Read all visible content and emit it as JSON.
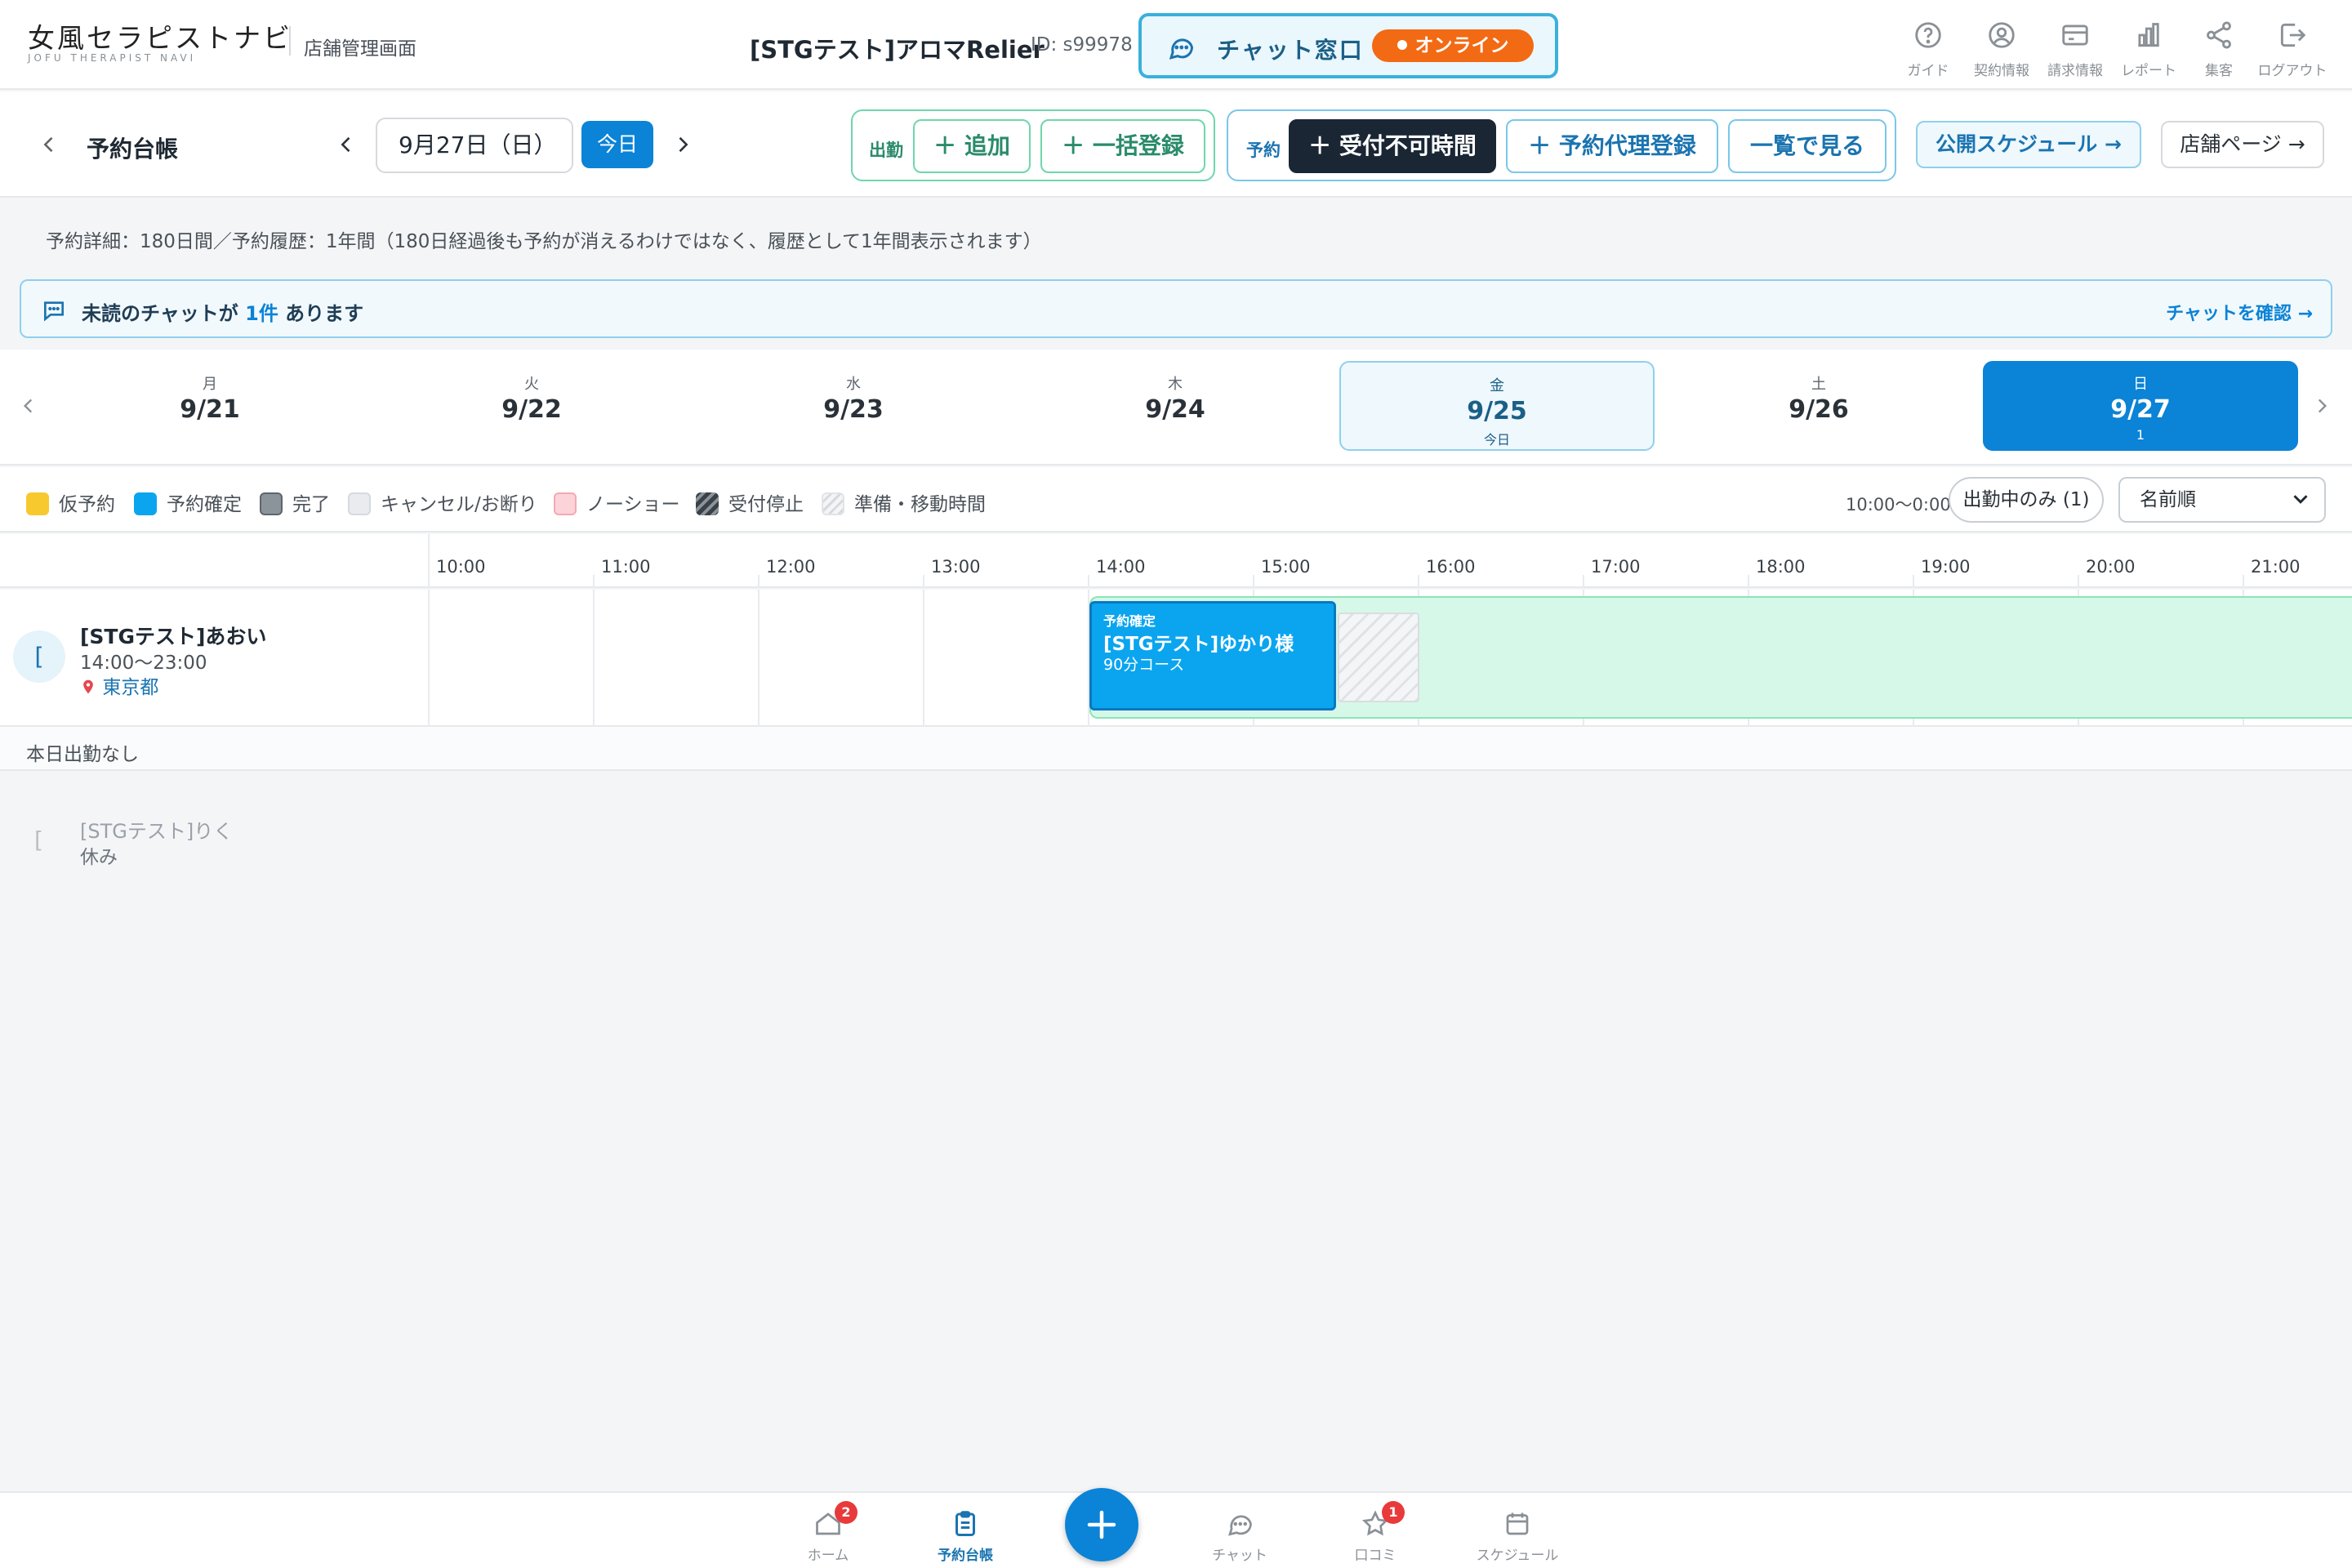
{
  "header": {
    "logo_main": "女風セラピストナビ",
    "logo_sub": "JOFU THERAPIST NAVI",
    "admin_label": "店舗管理画面",
    "shop_name": "[STGテスト]アロマRelier",
    "shop_id": "ID: s99978",
    "chat_window_label": "チャット窓口",
    "status_label": "オンライン",
    "nav": [
      {
        "label": "ガイド",
        "icon": "help-circle-icon"
      },
      {
        "label": "契約情報",
        "icon": "user-circle-icon"
      },
      {
        "label": "請求情報",
        "icon": "credit-card-icon"
      },
      {
        "label": "レポート",
        "icon": "bar-chart-icon"
      },
      {
        "label": "集客",
        "icon": "share-icon"
      },
      {
        "label": "ログアウト",
        "icon": "logout-icon"
      }
    ]
  },
  "toolbar": {
    "title": "予約台帳",
    "date": "9月27日（日）",
    "today": "今日",
    "shift_group": "出勤",
    "add": "＋ 追加",
    "bulk": "＋ 一括登録",
    "reserve_group": "予約",
    "unavailable": "＋ 受付不可時間",
    "proxy": "＋ 予約代理登録",
    "list": "一覧で見る",
    "public_schedule": "公開スケジュール →",
    "shop_page": "店舗ページ →"
  },
  "notice": "予約詳細：180日間／予約履歴：1年間（180日経過後も予約が消えるわけではなく、履歴として1年間表示されます）",
  "alert": {
    "pre": "未読のチャットが ",
    "count": "1件",
    "post": " あります",
    "link": "チャットを確認 →"
  },
  "week": [
    {
      "dow": "月",
      "date": "9/21",
      "sub": ""
    },
    {
      "dow": "火",
      "date": "9/22",
      "sub": ""
    },
    {
      "dow": "水",
      "date": "9/23",
      "sub": ""
    },
    {
      "dow": "木",
      "date": "9/24",
      "sub": ""
    },
    {
      "dow": "金",
      "date": "9/25",
      "sub": "今日"
    },
    {
      "dow": "土",
      "date": "9/26",
      "sub": ""
    },
    {
      "dow": "日",
      "date": "9/27",
      "sub": "1"
    }
  ],
  "legend": [
    {
      "label": "仮予約",
      "color": "#f7c92e"
    },
    {
      "label": "予約確定",
      "color": "#0ba5ef"
    },
    {
      "label": "完了",
      "color": "#8b939b"
    },
    {
      "label": "キャンセル/お断り",
      "color": "#e9ebee"
    },
    {
      "label": "ノーショー",
      "color": "#fbd3d8"
    },
    {
      "label": "受付停止",
      "color": "#6b737b"
    },
    {
      "label": "準備・移動時間",
      "color": "#eef0f2"
    }
  ],
  "filter": {
    "range": "10:00〜0:00",
    "working_only": "出勤中のみ (1)",
    "sort": "名前順"
  },
  "hours": [
    "10:00",
    "11:00",
    "12:00",
    "13:00",
    "14:00",
    "15:00",
    "16:00",
    "17:00",
    "18:00",
    "19:00",
    "20:00",
    "21:00"
  ],
  "therapist": {
    "avatar": "[",
    "name": "[STGテスト]あおい",
    "time": "14:00〜23:00",
    "location": "東京都"
  },
  "booking": {
    "status": "予約確定",
    "customer": "[STGテスト]ゆかり様",
    "course": "90分コース"
  },
  "off_section": {
    "header": "本日出勤なし",
    "avatar": "[",
    "name": "[STGテスト]りく",
    "status": "休み"
  },
  "bottom_nav": [
    {
      "label": "ホーム",
      "badge": "2"
    },
    {
      "label": "予約台帳",
      "badge": ""
    },
    {
      "label": "チャット",
      "badge": ""
    },
    {
      "label": "口コミ",
      "badge": "1"
    },
    {
      "label": "スケジュール",
      "badge": ""
    }
  ],
  "colors": {
    "accent": "#0b83d6",
    "online": "#f26a14",
    "available": "#d6f8e8",
    "booked": "#0ba5ef"
  }
}
